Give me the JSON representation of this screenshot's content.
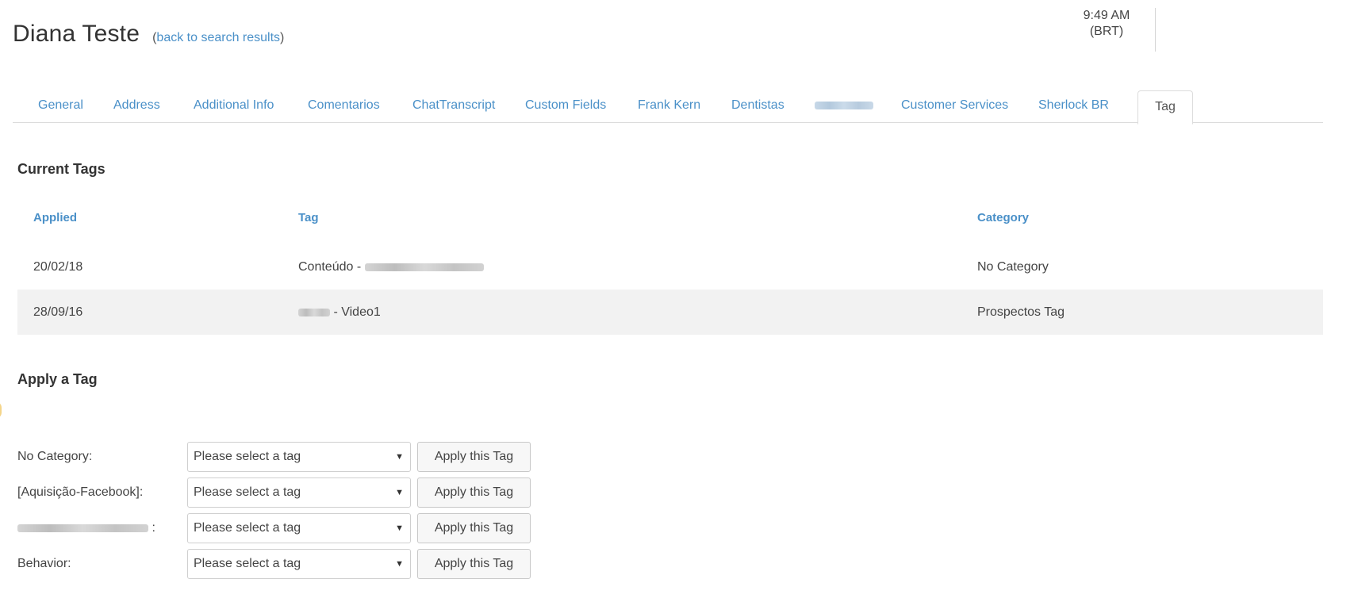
{
  "header": {
    "title": "Diana Teste",
    "back_link": "back to search results"
  },
  "clock": {
    "time": "9:49 AM",
    "zone": "(BRT)"
  },
  "tabs": [
    {
      "label": "General"
    },
    {
      "label": "Address"
    },
    {
      "label": "Additional Info"
    },
    {
      "label": "Comentarios"
    },
    {
      "label": "ChatTranscript"
    },
    {
      "label": "Custom Fields"
    },
    {
      "label": "Frank Kern"
    },
    {
      "label": "Dentistas"
    },
    {
      "label": ""
    },
    {
      "label": "Customer Services"
    },
    {
      "label": "Sherlock BR"
    },
    {
      "label": "Tag"
    }
  ],
  "current_tags": {
    "title": "Current Tags",
    "columns": {
      "applied": "Applied",
      "tag": "Tag",
      "category": "Category"
    },
    "rows": [
      {
        "applied": "20/02/18",
        "tag": "Conteúdo -",
        "category": "No Category"
      },
      {
        "applied": "28/09/16",
        "tag": "- Video1",
        "category": "Prospectos Tag"
      }
    ]
  },
  "apply_tag": {
    "title": "Apply a Tag",
    "select_placeholder": "Please select a tag",
    "button_label": "Apply this Tag",
    "rows": [
      {
        "label": "No Category:"
      },
      {
        "label": "[Aquisição-Facebook]:"
      },
      {
        "label": ":"
      },
      {
        "label": "Behavior:"
      }
    ]
  }
}
